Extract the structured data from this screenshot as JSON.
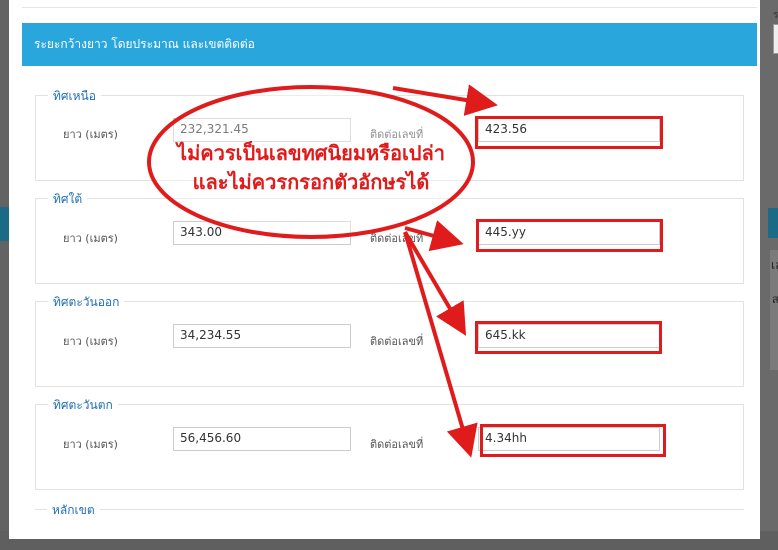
{
  "panel_title": "ระยะกว้างยาว โดยประมาณ และเขตติดต่อ",
  "length_label": "ยาว (เมตร)",
  "adjacent_label": "ติดต่อเลขที่",
  "sections": [
    {
      "legend": "ทิศเหนือ",
      "length": "232,321.45",
      "adjacent": "423.56"
    },
    {
      "legend": "ทิศใต้",
      "length": "343.00",
      "adjacent": "445.yy"
    },
    {
      "legend": "ทิศตะวันออก",
      "length": "34,234.55",
      "adjacent": "645.kk"
    },
    {
      "legend": "ทิศตะวันตก",
      "length": "56,456.60",
      "adjacent": "4.34hh"
    }
  ],
  "last_section_legend": "หลักเขต",
  "annotation": {
    "line1": "ไม่ควรเป็นเลขทศนิยมหรือเปล่า",
    "line2": "และไม่ควรกรอกตัวอักษรได้",
    "color": "#e01b1b"
  },
  "background": {
    "right_text1": "เล",
    "right_text2": "ส",
    "right_text3": "ร"
  },
  "colors": {
    "header": "#29a6dc",
    "legend": "#1f6fb2",
    "overlay": "#5f5f5f"
  }
}
